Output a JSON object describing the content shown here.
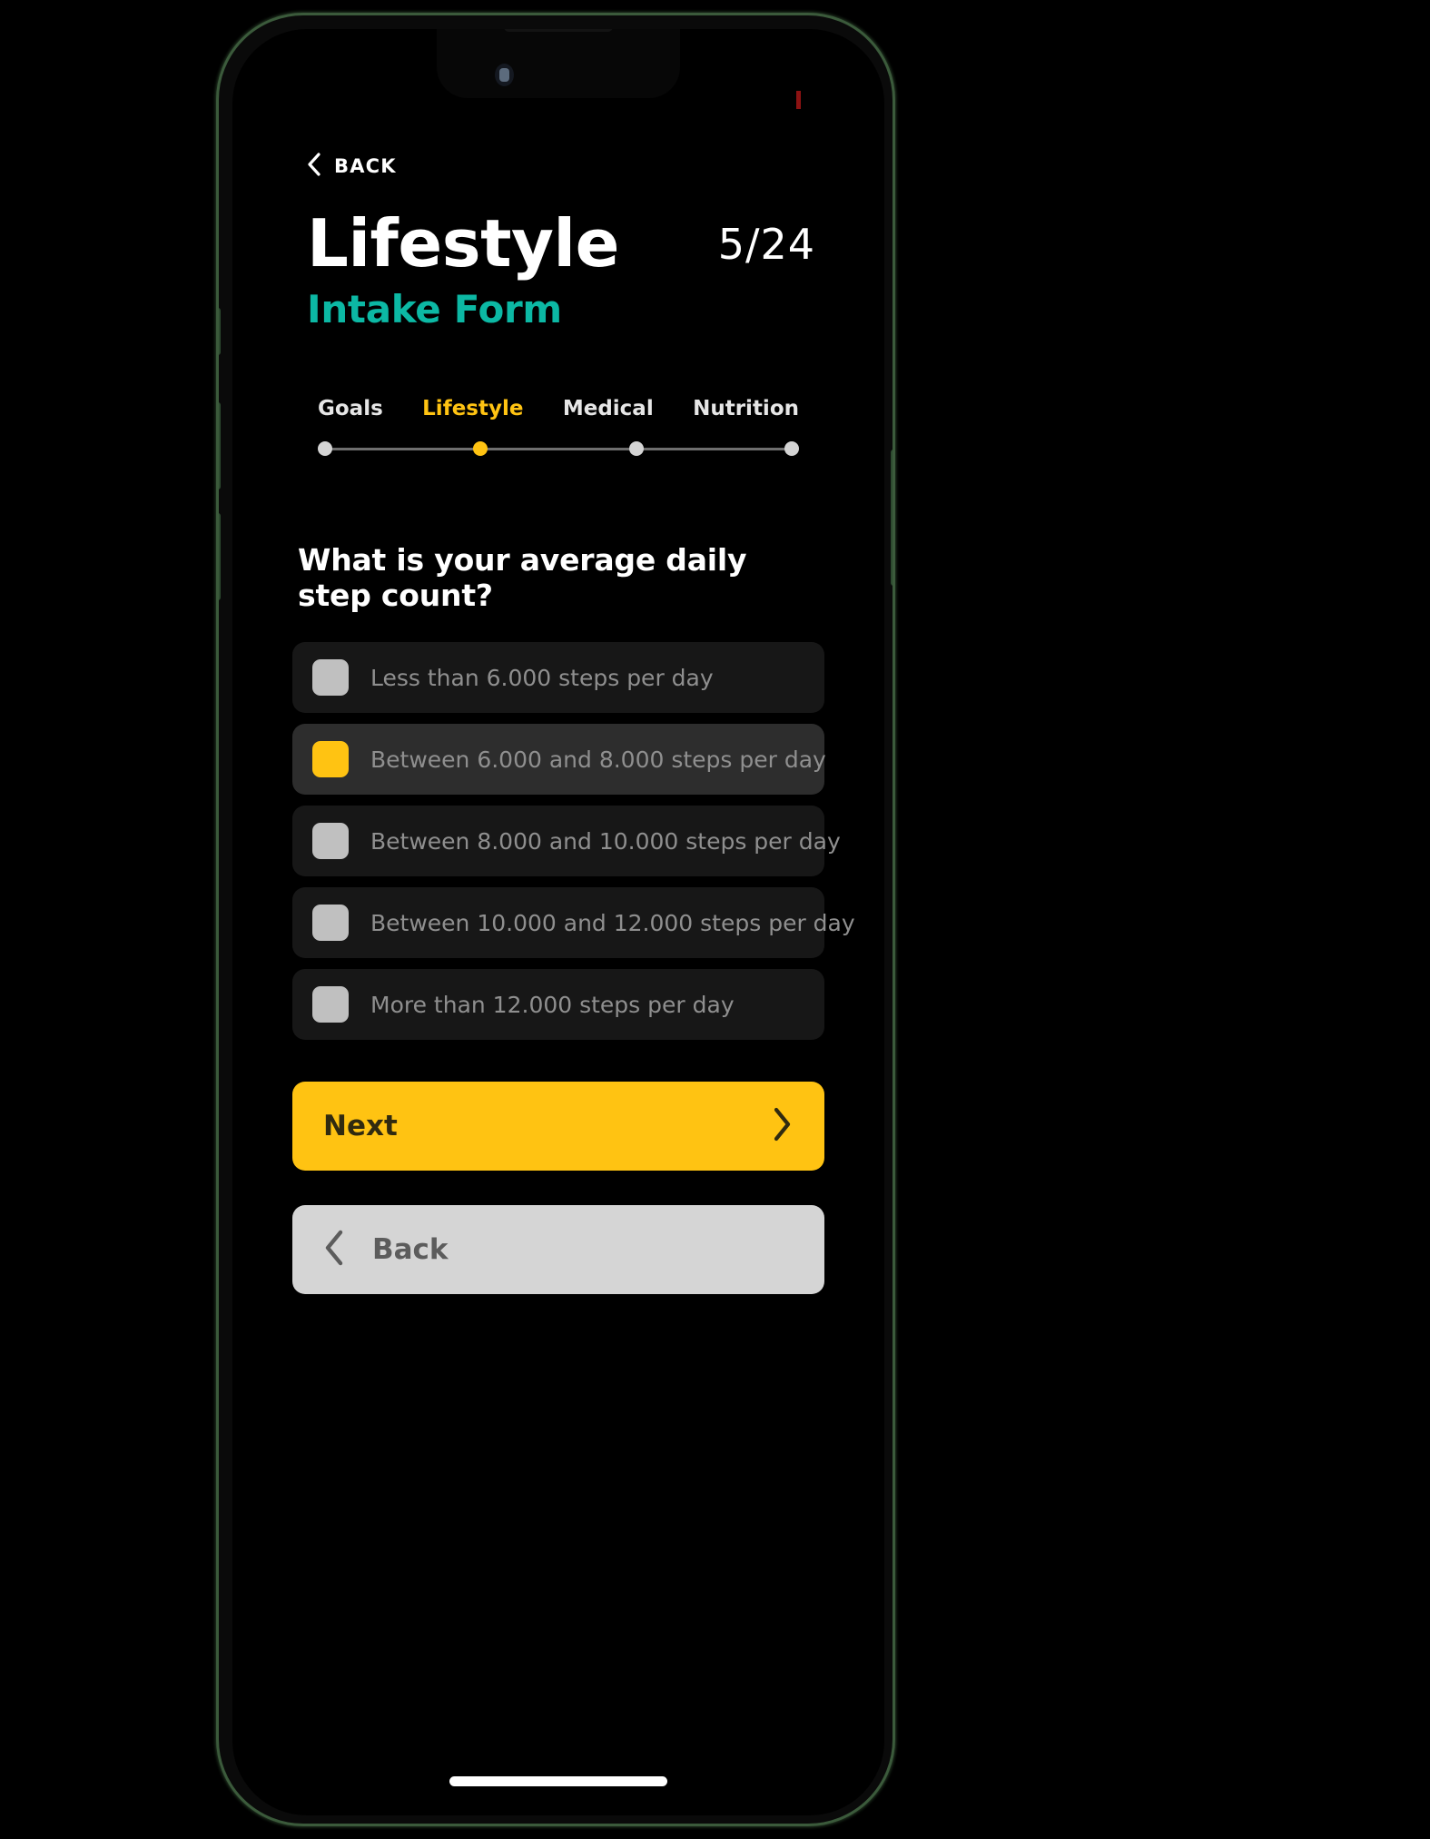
{
  "colors": {
    "accent_yellow": "#ffc312",
    "teal": "#0cb8a4",
    "screen_bg": "#000000",
    "card_bg": "#171717",
    "card_bg_selected": "#2d2d2d",
    "back_button_bg": "#d5d5d5",
    "bezel_green": "#3b5a3b",
    "status_indicator_red": "#8c1212"
  },
  "device": {
    "notch_camera_icon": "front-camera-icon",
    "status_indicator_icon": "recording-indicator-icon",
    "home_indicator_icon": "home-indicator-bar"
  },
  "header": {
    "back_link_label": "BACK",
    "back_link_icon": "chevron-left-icon",
    "title": "Lifestyle",
    "subtitle": "Intake Form",
    "counter": "5/24"
  },
  "stepper": {
    "steps": [
      {
        "label": "Goals",
        "active": false
      },
      {
        "label": "Lifestyle",
        "active": true
      },
      {
        "label": "Medical",
        "active": false
      },
      {
        "label": "Nutrition",
        "active": false
      }
    ]
  },
  "question": {
    "text": "What is your average daily step count?",
    "options": [
      {
        "label": "Less than 6.000 steps per day",
        "selected": false
      },
      {
        "label": "Between 6.000 and 8.000 steps per day",
        "selected": true
      },
      {
        "label": "Between 8.000 and 10.000 steps per day",
        "selected": false
      },
      {
        "label": "Between 10.000 and 12.000 steps per day",
        "selected": false
      },
      {
        "label": "More than 12.000 steps per day",
        "selected": false
      }
    ]
  },
  "actions": {
    "next_label": "Next",
    "next_icon": "chevron-right-icon",
    "back_label": "Back",
    "back_icon": "chevron-left-icon"
  }
}
